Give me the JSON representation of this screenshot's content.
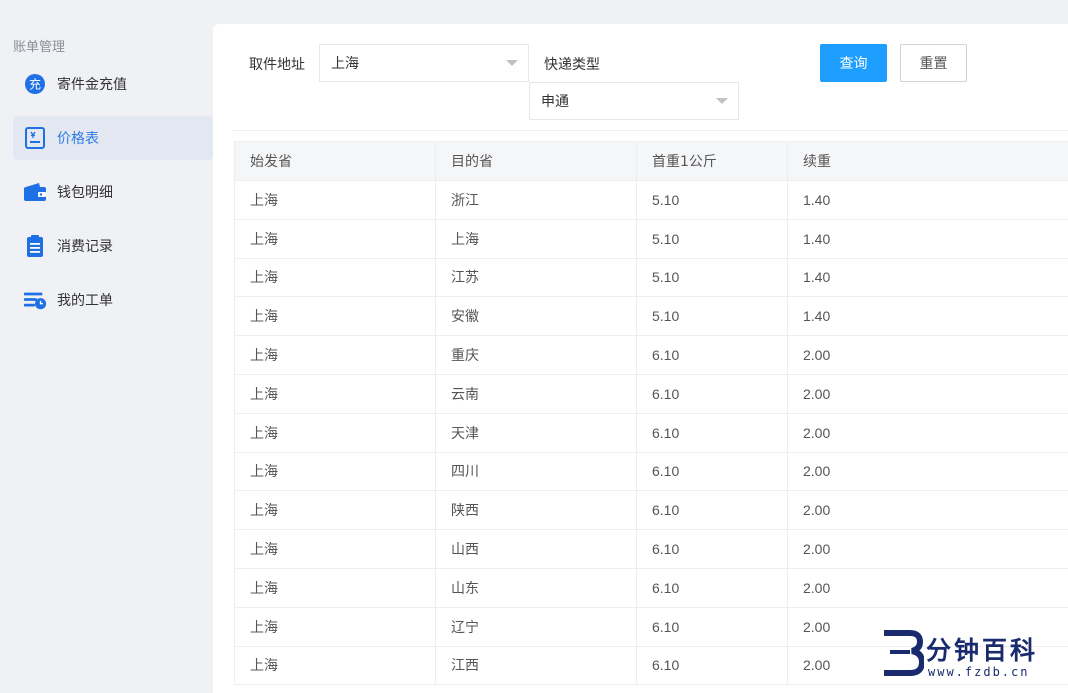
{
  "sidebar": {
    "group_title": "账单管理",
    "items": [
      {
        "label": "寄件金充值",
        "icon": "recharge-icon",
        "icon_text": "充",
        "active": false
      },
      {
        "label": "价格表",
        "icon": "price-list-icon",
        "active": true
      },
      {
        "label": "钱包明细",
        "icon": "wallet-icon",
        "active": false
      },
      {
        "label": "消费记录",
        "icon": "record-icon",
        "active": false
      },
      {
        "label": "我的工单",
        "icon": "work-order-icon",
        "active": false
      }
    ]
  },
  "filters": {
    "pickup_label": "取件地址",
    "pickup_value": "上海",
    "express_label": "快递类型",
    "express_value": "申通",
    "query_button": "查询",
    "reset_button": "重置"
  },
  "table": {
    "headers": [
      "始发省",
      "目的省",
      "首重1公斤",
      "续重"
    ],
    "rows": [
      [
        "上海",
        "浙江",
        "5.10",
        "1.40"
      ],
      [
        "上海",
        "上海",
        "5.10",
        "1.40"
      ],
      [
        "上海",
        "江苏",
        "5.10",
        "1.40"
      ],
      [
        "上海",
        "安徽",
        "5.10",
        "1.40"
      ],
      [
        "上海",
        "重庆",
        "6.10",
        "2.00"
      ],
      [
        "上海",
        "云南",
        "6.10",
        "2.00"
      ],
      [
        "上海",
        "天津",
        "6.10",
        "2.00"
      ],
      [
        "上海",
        "四川",
        "6.10",
        "2.00"
      ],
      [
        "上海",
        "陕西",
        "6.10",
        "2.00"
      ],
      [
        "上海",
        "山西",
        "6.10",
        "2.00"
      ],
      [
        "上海",
        "山东",
        "6.10",
        "2.00"
      ],
      [
        "上海",
        "辽宁",
        "6.10",
        "2.00"
      ],
      [
        "上海",
        "江西",
        "6.10",
        "2.00"
      ]
    ]
  },
  "watermark": {
    "title": "分钟百科",
    "url": "www.fzdb.cn"
  },
  "colors": {
    "accent": "#1e9fff",
    "active_text": "#2f7be3",
    "active_bg": "#e3e8f3",
    "icon_blue": "#1f6fe5"
  }
}
